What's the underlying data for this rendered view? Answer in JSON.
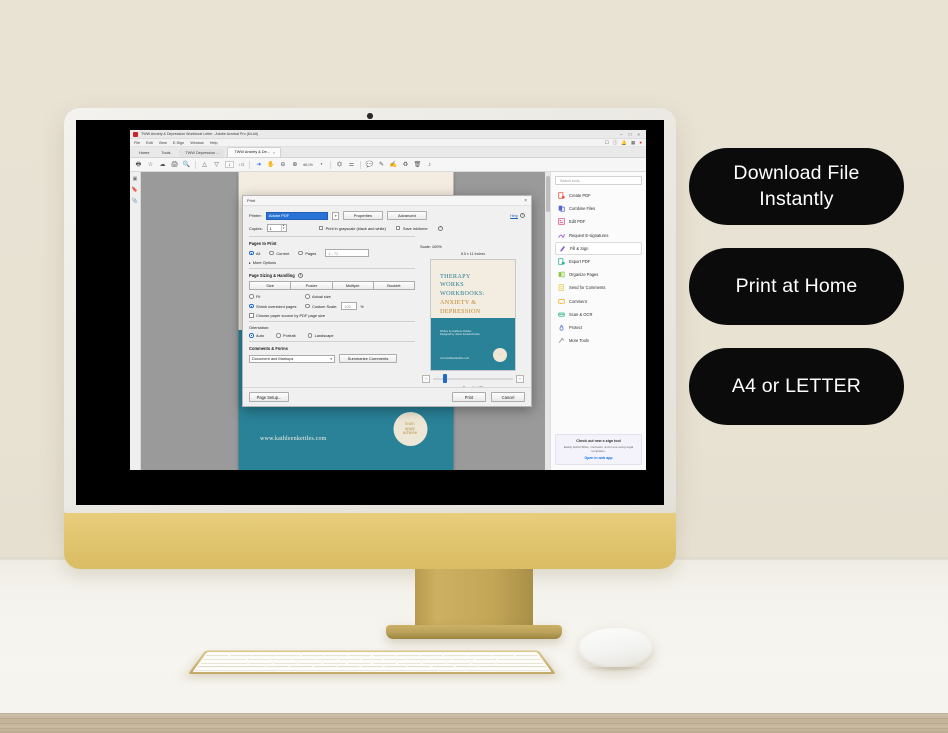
{
  "scene": {
    "wall_color": "#e8e2d3",
    "desk_color": "#f5f3ed",
    "imac_chin_color": "#e2c670"
  },
  "cta_buttons": [
    {
      "label": "Download File Instantly"
    },
    {
      "label": "Print at Home"
    },
    {
      "label": "A4 or LETTER"
    }
  ],
  "acrobat": {
    "window_title": "TWW Anxiety & Depression Workbook Letter - Adobe Acrobat Pro (64-bit)",
    "window_controls": {
      "minimize": "–",
      "maximize": "□",
      "close": "×"
    },
    "menu": [
      "File",
      "Edit",
      "View",
      "E-Sign",
      "Window",
      "Help"
    ],
    "nav_tabs": [
      "Home",
      "Tools"
    ],
    "doc_tabs": [
      {
        "label": "TWW Depression ...",
        "active": false,
        "close": "×"
      },
      {
        "label": "TWW Anxiety & De...",
        "active": true,
        "close": "×"
      }
    ],
    "toolbar": {
      "save_icon": "save-icon",
      "star_icon": "star-icon",
      "cloud_icon": "cloud-icon",
      "print_icon": "print-icon",
      "search_icon": "search-icon",
      "prev_page_icon": "previous-page-icon",
      "next_page_icon": "next-page-icon",
      "page_number": "1",
      "page_total": "/ 72",
      "select_tool_icon": "cursor-icon",
      "hand_tool_icon": "hand-icon",
      "zoom_out_icon": "zoom-out-icon",
      "zoom_in_icon": "zoom-in-icon",
      "zoom_level": "66.1%",
      "fit_icon": "fit-page-icon",
      "read_mode_icon": "read-mode-icon",
      "comment_icon": "comment-icon",
      "highlight_icon": "highlight-icon",
      "sign_icon": "sign-icon",
      "stamp_icon": "stamp-icon",
      "delete_icon": "delete-icon",
      "headphones_icon": "headphones-icon"
    },
    "tools_panel": {
      "search_placeholder": "Search tools",
      "items": [
        {
          "label": "Create PDF",
          "color": "#e8553c",
          "selected": false
        },
        {
          "label": "Combine Files",
          "color": "#5466d6",
          "selected": false
        },
        {
          "label": "Edit PDF",
          "color": "#e0448e",
          "selected": false
        },
        {
          "label": "Request E-signatures",
          "color": "#9b4fd6",
          "selected": false
        },
        {
          "label": "Fill & Sign",
          "color": "#8a5ae0",
          "selected": true
        },
        {
          "label": "Export PDF",
          "color": "#2eaf9b",
          "selected": false
        },
        {
          "label": "Organize Pages",
          "color": "#8cc63f",
          "selected": false
        },
        {
          "label": "Send for Comments",
          "color": "#e8c93c",
          "selected": false
        },
        {
          "label": "Comment",
          "color": "#f0b429",
          "selected": false
        },
        {
          "label": "Scan & OCR",
          "color": "#37b68a",
          "selected": false
        },
        {
          "label": "Protect",
          "color": "#5b7fd4",
          "selected": false
        },
        {
          "label": "More Tools",
          "color": "#8a8a8a",
          "selected": false
        }
      ],
      "promo": {
        "title": "Check out new e-sign tool",
        "subtitle": "Easily build NDAs, contracts, and more using legal templates.",
        "link": "Open in web app"
      }
    },
    "document": {
      "url_text": "www.kathleenkettles.com",
      "badge_lines": [
        "learn",
        "apply",
        "achieve"
      ]
    }
  },
  "print_dialog": {
    "title": "Print",
    "close_label": "×",
    "printer_label": "Printer:",
    "printer_value": "Adobe PDF",
    "properties_button": "Properties",
    "advanced_button": "Advanced",
    "help_link": "Help",
    "copies_label": "Copies:",
    "copies_value": "1",
    "grayscale_checkbox": "Print in grayscale (black and white)",
    "save_ink_checkbox": "Save ink/toner",
    "pages_to_print_title": "Pages to Print",
    "pages_options": [
      "All",
      "Current",
      "Pages"
    ],
    "pages_selected": "All",
    "pages_range_value": "1 - 72",
    "more_options_label": "More Options",
    "page_sizing_title": "Page Sizing & Handling",
    "sizing_tabs": [
      "Size",
      "Poster",
      "Multiple",
      "Booklet"
    ],
    "sizing_tab_selected": "Size",
    "size_options": [
      "Fit",
      "Actual size",
      "Shrink oversized pages",
      "Custom Scale:"
    ],
    "size_selected": "Shrink oversized pages",
    "custom_scale_value": "100",
    "custom_scale_unit": "%",
    "paper_source_checkbox": "Choose paper source by PDF page size",
    "orientation_title": "Orientation:",
    "orientation_options": [
      "Auto",
      "Portrait",
      "Landscape"
    ],
    "orientation_selected": "Auto",
    "comments_title": "Comments & Forms",
    "comments_value": "Document and Markups",
    "summarize_button": "Summarize Comments",
    "scale_label": "Scale: 100%",
    "paper_dimensions": "8.5 x 11 Inches",
    "preview_page_label": "Page 1 of 72",
    "prev_arrow": "‹",
    "next_arrow": "›",
    "page_setup_button": "Page Setup...",
    "print_button": "Print",
    "cancel_button": "Cancel",
    "preview_cover": {
      "line1": "THERAPY",
      "line2": "WORKS",
      "line3": "WORKBOOKS:",
      "line4": "ANXIETY &",
      "line5": "DEPRESSION",
      "author_line1": "Written by Kathleen Kettles",
      "author_line2": "Designed by Jason Kreisel-Kuzela",
      "url": "www.kathleenkettles.com",
      "badge": "learn apply achieve"
    }
  }
}
